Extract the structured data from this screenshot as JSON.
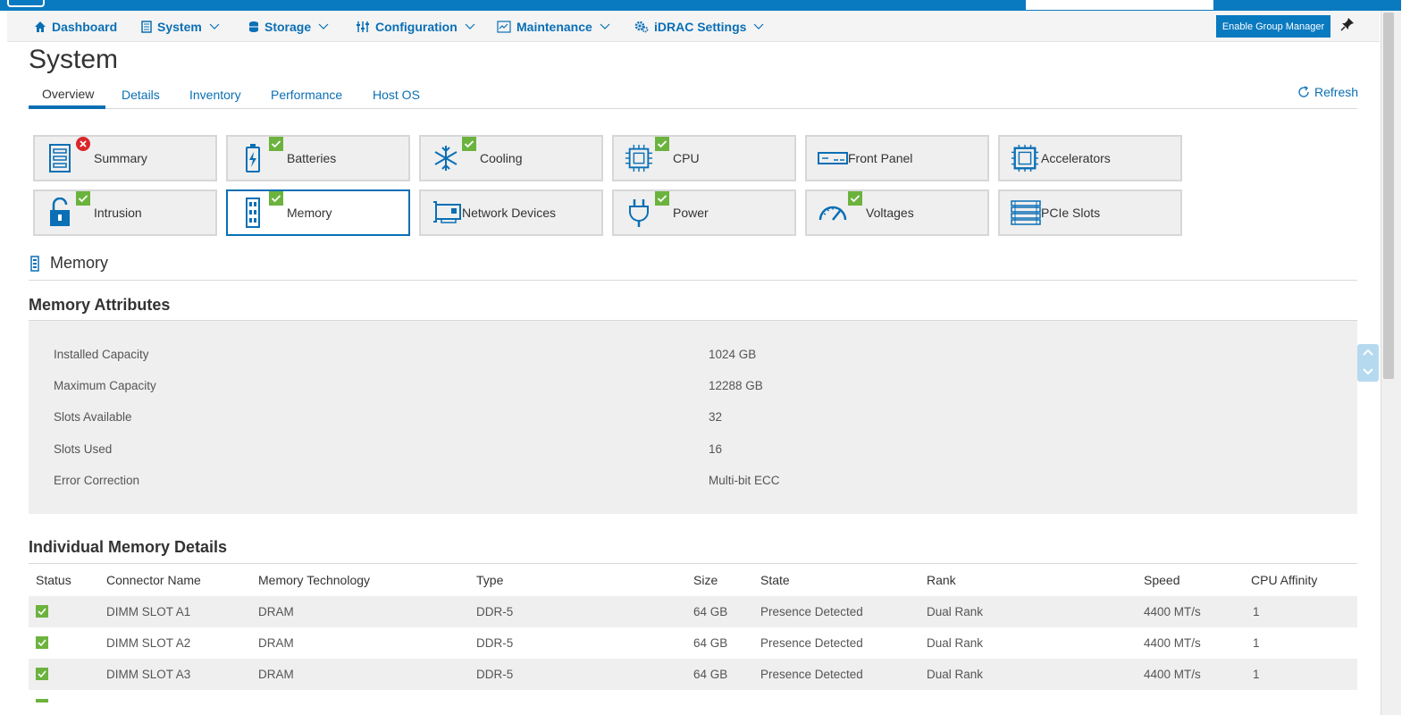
{
  "nav": {
    "items": [
      {
        "label": "Dashboard",
        "icon": "home-icon",
        "has_dropdown": false
      },
      {
        "label": "System",
        "icon": "system-icon",
        "has_dropdown": true
      },
      {
        "label": "Storage",
        "icon": "storage-icon",
        "has_dropdown": true
      },
      {
        "label": "Configuration",
        "icon": "sliders-icon",
        "has_dropdown": true
      },
      {
        "label": "Maintenance",
        "icon": "maintenance-icon",
        "has_dropdown": true
      },
      {
        "label": "iDRAC Settings",
        "icon": "gears-icon",
        "has_dropdown": true
      }
    ],
    "group_manager_button": "Enable Group Manager",
    "pin_icon": "pin-icon"
  },
  "page": {
    "title": "System",
    "tabs": [
      {
        "label": "Overview",
        "active": true
      },
      {
        "label": "Details",
        "active": false
      },
      {
        "label": "Inventory",
        "active": false
      },
      {
        "label": "Performance",
        "active": false
      },
      {
        "label": "Host OS",
        "active": false
      }
    ],
    "refresh_label": "Refresh"
  },
  "tiles": [
    {
      "label": "Summary",
      "icon": "summary-icon",
      "status": "critical"
    },
    {
      "label": "Batteries",
      "icon": "battery-icon",
      "status": "ok"
    },
    {
      "label": "Cooling",
      "icon": "snowflake-icon",
      "status": "ok"
    },
    {
      "label": "CPU",
      "icon": "cpu-icon",
      "status": "ok"
    },
    {
      "label": "Front Panel",
      "icon": "front-panel-icon",
      "status": "none"
    },
    {
      "label": "Accelerators",
      "icon": "accelerator-icon",
      "status": "none"
    },
    {
      "label": "Intrusion",
      "icon": "lock-icon",
      "status": "ok"
    },
    {
      "label": "Memory",
      "icon": "memory-icon",
      "status": "ok",
      "selected": true
    },
    {
      "label": "Network Devices",
      "icon": "network-card-icon",
      "status": "none"
    },
    {
      "label": "Power",
      "icon": "plug-icon",
      "status": "ok"
    },
    {
      "label": "Voltages",
      "icon": "gauge-icon",
      "status": "ok"
    },
    {
      "label": "PCIe Slots",
      "icon": "pcie-icon",
      "status": "none"
    }
  ],
  "memory_section": {
    "heading": "Memory",
    "attributes_heading": "Memory Attributes",
    "attributes": [
      {
        "label": "Installed Capacity",
        "value": "1024 GB"
      },
      {
        "label": "Maximum Capacity",
        "value": "12288 GB"
      },
      {
        "label": "Slots Available",
        "value": "32"
      },
      {
        "label": "Slots Used",
        "value": "16"
      },
      {
        "label": "Error Correction",
        "value": "Multi-bit ECC"
      }
    ],
    "details_heading": "Individual Memory Details",
    "columns": [
      "Status",
      "Connector Name",
      "Memory Technology",
      "Type",
      "Size",
      "State",
      "Rank",
      "Speed",
      "CPU Affinity"
    ],
    "rows": [
      {
        "status": "ok",
        "connector": "DIMM SLOT A1",
        "technology": "DRAM",
        "type": "DDR-5",
        "size": "64 GB",
        "state": "Presence Detected",
        "rank": "Dual Rank",
        "speed": "4400 MT/s",
        "affinity": "1"
      },
      {
        "status": "ok",
        "connector": "DIMM SLOT A2",
        "technology": "DRAM",
        "type": "DDR-5",
        "size": "64 GB",
        "state": "Presence Detected",
        "rank": "Dual Rank",
        "speed": "4400 MT/s",
        "affinity": "1"
      },
      {
        "status": "ok",
        "connector": "DIMM SLOT A3",
        "technology": "DRAM",
        "type": "DDR-5",
        "size": "64 GB",
        "state": "Presence Detected",
        "rank": "Dual Rank",
        "speed": "4400 MT/s",
        "affinity": "1"
      }
    ]
  },
  "colors": {
    "accent": "#0a6fb5",
    "ok": "#6cb33e",
    "critical": "#d9262c"
  }
}
